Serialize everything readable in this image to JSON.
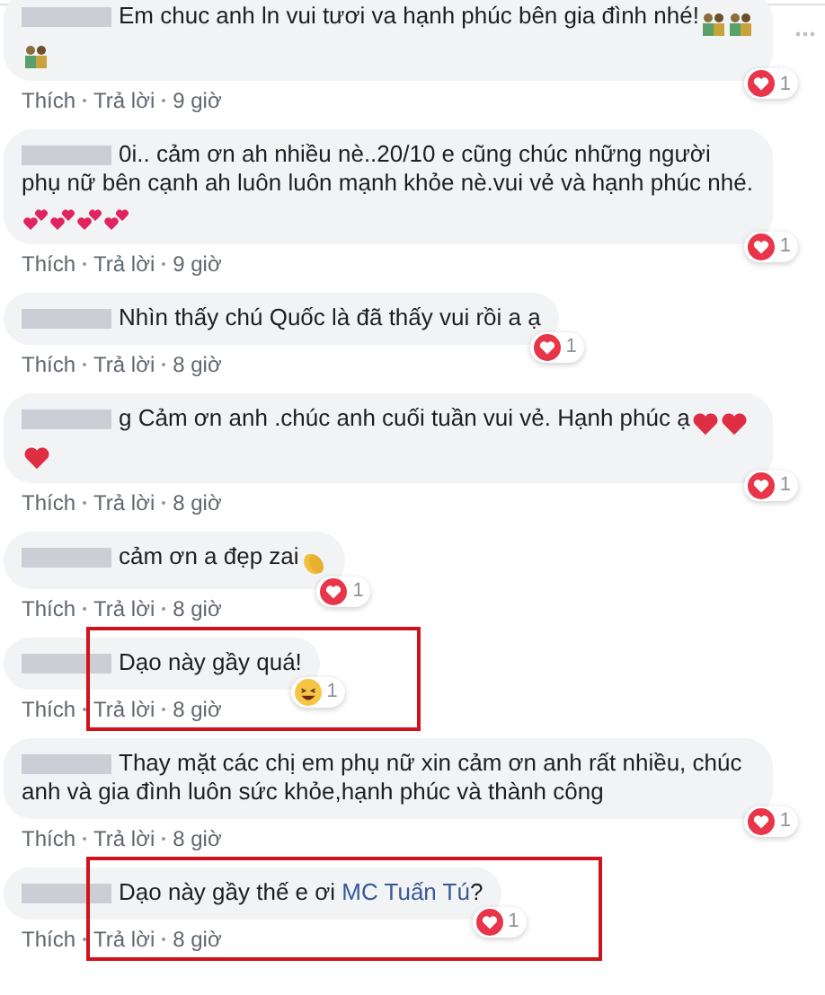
{
  "comments": [
    {
      "parts": [
        {
          "kind": "text",
          "text": "Em chuc anh ln vui tươi va hạnh phúc bên gia đình nhé!"
        }
      ],
      "emojis": [
        {
          "kind": "couple"
        },
        {
          "kind": "couple"
        },
        {
          "kind": "couple"
        }
      ],
      "reaction": {
        "kind": "love",
        "count": "1"
      },
      "actions": [
        "Thích",
        "Trả lời",
        "9 giờ"
      ],
      "highlighted": false,
      "options_visible": true
    },
    {
      "parts": [
        {
          "kind": "text",
          "text": "0i.. cảm ơn ah nhiều nè..20/10 e cũng chúc những người phụ nữ bên cạnh ah luôn luôn mạnh khỏe nè.vui vẻ và hạnh phúc nhé."
        }
      ],
      "emojis": [
        {
          "kind": "two-hearts"
        },
        {
          "kind": "two-hearts"
        },
        {
          "kind": "two-hearts"
        },
        {
          "kind": "two-hearts"
        }
      ],
      "reaction": {
        "kind": "love",
        "count": "1"
      },
      "actions": [
        "Thích",
        "Trả lời",
        "9 giờ"
      ],
      "highlighted": false,
      "options_visible": false
    },
    {
      "parts": [
        {
          "kind": "text",
          "text": "Nhìn thấy chú Quốc là đã thấy vui rồi a ạ"
        }
      ],
      "reaction": {
        "kind": "love",
        "count": "1"
      },
      "actions": [
        "Thích",
        "Trả lời",
        "8 giờ"
      ],
      "highlighted": false,
      "options_visible": false
    },
    {
      "parts": [
        {
          "kind": "text",
          "text": "g Cảm ơn anh .chúc anh cuối tuần vui vẻ. Hạnh phúc ạ"
        }
      ],
      "emojis": [
        {
          "kind": "heart"
        },
        {
          "kind": "heart"
        },
        {
          "kind": "heart"
        }
      ],
      "reaction": {
        "kind": "love",
        "count": "1"
      },
      "actions": [
        "Thích",
        "Trả lời",
        "8 giờ"
      ],
      "highlighted": false,
      "options_visible": false
    },
    {
      "parts": [
        {
          "kind": "text",
          "text": "cảm ơn a đẹp zai"
        }
      ],
      "emojis": [
        {
          "kind": "clap"
        }
      ],
      "reaction": {
        "kind": "love",
        "count": "1"
      },
      "actions": [
        "Thích",
        "Trả lời",
        "8 giờ"
      ],
      "highlighted": false,
      "options_visible": false
    },
    {
      "parts": [
        {
          "kind": "text",
          "text": "Dạo này gầy quá!"
        }
      ],
      "reaction": {
        "kind": "haha",
        "count": "1"
      },
      "actions": [
        "Thích",
        "Trả lời",
        "8 giờ"
      ],
      "highlighted": true,
      "options_visible": false
    },
    {
      "parts": [
        {
          "kind": "text",
          "text": "Thay mặt các chị em phụ nữ xin cảm ơn anh rất nhiều, chúc anh và gia đình luôn sức khỏe,hạnh phúc và thành công"
        }
      ],
      "reaction": {
        "kind": "love",
        "count": "1"
      },
      "actions": [
        "Thích",
        "Trả lời",
        "8 giờ"
      ],
      "highlighted": false,
      "options_visible": false
    },
    {
      "parts": [
        {
          "kind": "text",
          "text": "Dạo này gầy thế e ơi "
        },
        {
          "kind": "mention",
          "text": "MC Tuấn Tú"
        },
        {
          "kind": "text",
          "text": "?"
        }
      ],
      "reaction": {
        "kind": "love",
        "count": "1"
      },
      "actions": [
        "Thích",
        "Trả lời",
        "8 giờ"
      ],
      "highlighted": true,
      "options_visible": false
    }
  ]
}
